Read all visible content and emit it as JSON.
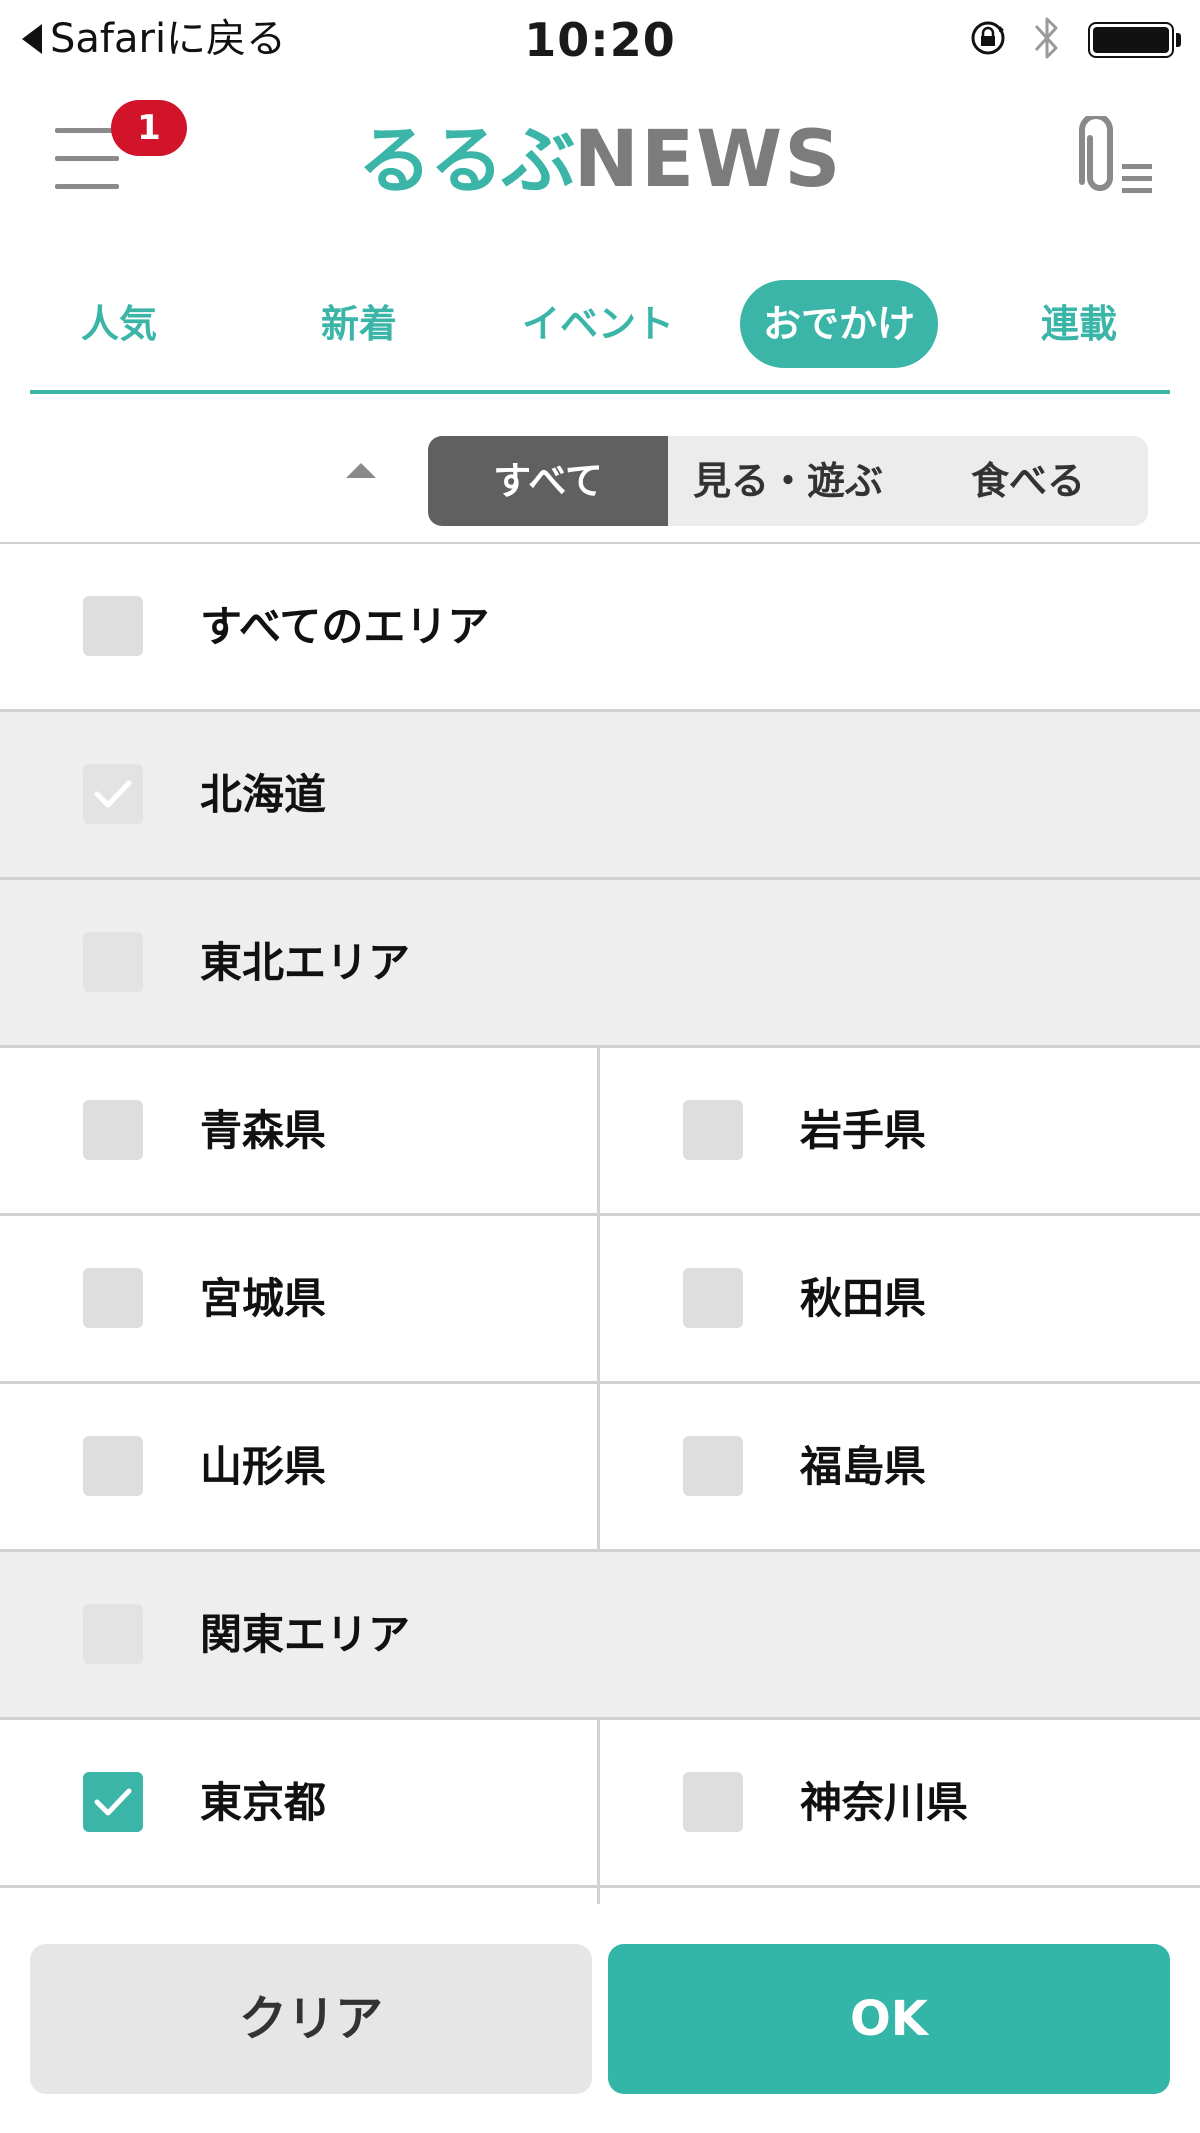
{
  "status_bar": {
    "back_label": "Safariに戻る",
    "time": "10:20"
  },
  "header": {
    "notification_count": "1",
    "logo_jp": "るるぶ",
    "logo_en": "NEWS"
  },
  "tabs": [
    {
      "label": "人気",
      "active": false
    },
    {
      "label": "新着",
      "active": false
    },
    {
      "label": "イベント",
      "active": false
    },
    {
      "label": "おでかけ",
      "active": true
    },
    {
      "label": "連載",
      "active": false
    }
  ],
  "segment": {
    "items": [
      "すべて",
      "見る・遊ぶ",
      "食べる"
    ],
    "selected": "すべて"
  },
  "areas": {
    "all": {
      "label": "すべてのエリア",
      "checked": false
    },
    "hokkaido": {
      "label": "北海道",
      "checked": true
    },
    "tohoku": {
      "label": "東北エリア",
      "checked": false
    },
    "aomori": {
      "label": "青森県",
      "checked": false
    },
    "iwate": {
      "label": "岩手県",
      "checked": false
    },
    "miyagi": {
      "label": "宮城県",
      "checked": false
    },
    "akita": {
      "label": "秋田県",
      "checked": false
    },
    "yamagata": {
      "label": "山形県",
      "checked": false
    },
    "fukushima": {
      "label": "福島県",
      "checked": false
    },
    "kanto": {
      "label": "関東エリア",
      "checked": false
    },
    "tokyo": {
      "label": "東京都",
      "checked": true
    },
    "kanagawa": {
      "label": "神奈川県",
      "checked": false
    }
  },
  "buttons": {
    "clear": "クリア",
    "ok": "OK"
  },
  "colors": {
    "accent": "#3ab5a8",
    "badge": "#d2142a",
    "segment_active": "#606060"
  }
}
